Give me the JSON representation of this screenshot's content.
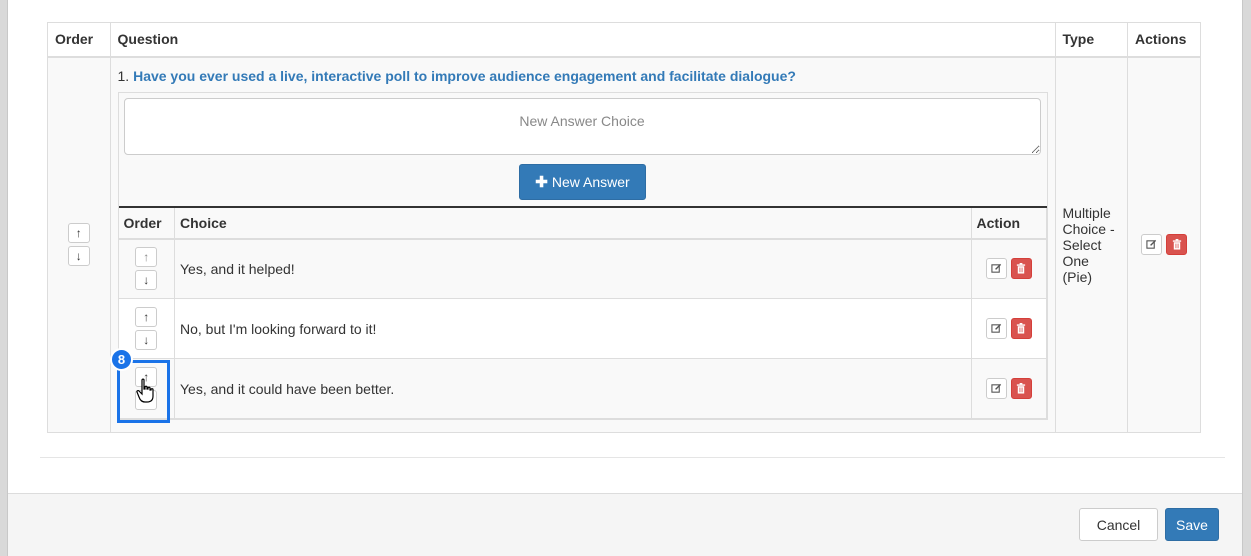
{
  "table": {
    "headers": {
      "order": "Order",
      "question": "Question",
      "type": "Type",
      "actions": "Actions"
    },
    "question": {
      "number": "1.",
      "text": "Have you ever used a live, interactive poll to improve audience engagement and facilitate dialogue?",
      "type": "Multiple Choice - Select One (Pie)"
    }
  },
  "answer_input": {
    "placeholder": "New Answer Choice"
  },
  "new_answer_button": {
    "label": "New Answer",
    "icon": "plus-icon"
  },
  "choices_table": {
    "headers": {
      "order": "Order",
      "choice": "Choice",
      "action": "Action"
    },
    "rows": [
      {
        "text": "Yes, and it helped!"
      },
      {
        "text": "No, but I'm looking forward to it!"
      },
      {
        "text": "Yes, and it could have been better."
      }
    ]
  },
  "step_badge": "8",
  "footer": {
    "cancel_label": "Cancel",
    "save_label": "Save"
  },
  "colors": {
    "primary": "#337ab7",
    "danger": "#d9534f",
    "highlight": "#1a73e8"
  }
}
